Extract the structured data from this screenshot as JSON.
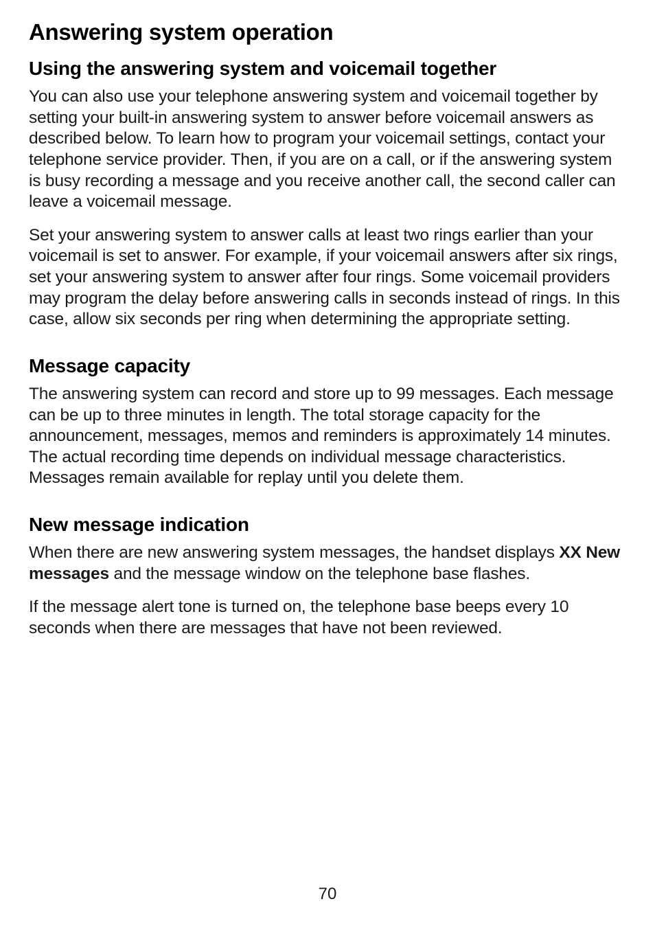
{
  "page": {
    "title": "Answering system operation",
    "number": "70"
  },
  "sections": {
    "s1": {
      "heading": "Using the answering system and voicemail together",
      "p1": "You can also use your telephone answering system and voicemail together by setting your built-in answering system to answer before voicemail answers as described below. To learn how to program your voicemail settings, contact your telephone service provider. Then, if you are on a call, or if the answering system is busy recording a message and you receive another call, the second caller can leave a voicemail message.",
      "p2": "Set your answering system to answer calls at least two rings earlier than your voicemail is set to answer. For example, if your voicemail answers after six rings, set your answering system to answer after four rings. Some voicemail providers may program the delay before answering calls in seconds instead of rings. In this case, allow six seconds per ring when determining the appropriate setting."
    },
    "s2": {
      "heading": "Message capacity",
      "p1": "The answering system can record and store up to 99 messages. Each message can be up to three minutes in length. The total storage capacity for the announcement, messages, memos and reminders is approximately 14 minutes. The actual recording time depends on individual message characteristics. Messages remain available for replay until you delete them."
    },
    "s3": {
      "heading": "New message indication",
      "p1_before": "When there are new answering system messages, the handset displays ",
      "p1_bold": "XX New messages",
      "p1_after": " and the message window on the telephone base flashes.",
      "p2": "If the message alert tone is turned on, the telephone base beeps every 10 seconds when there are messages that have not been reviewed."
    }
  }
}
